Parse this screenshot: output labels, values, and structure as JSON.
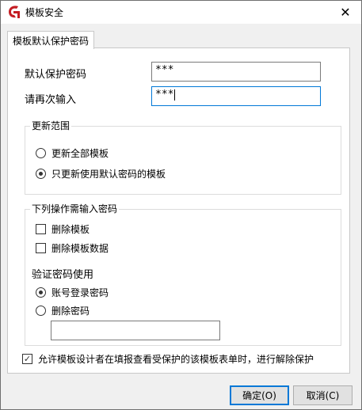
{
  "window": {
    "title": "模板安全",
    "close_glyph": "✕"
  },
  "tabs": [
    {
      "label": "模板默认保护密码"
    }
  ],
  "fields": {
    "default_password": {
      "label": "默认保护密码",
      "value": "***"
    },
    "reenter_password": {
      "label": "请再次输入",
      "value": "***"
    }
  },
  "update_scope": {
    "title": "更新范围",
    "options": [
      {
        "label": "更新全部模板",
        "selected": false
      },
      {
        "label": "只更新使用默认密码的模板",
        "selected": true
      }
    ]
  },
  "ops_require_password": {
    "title": "下列操作需输入密码",
    "items": [
      {
        "label": "删除模板",
        "checked": false
      },
      {
        "label": "删除模板数据",
        "checked": false
      }
    ],
    "verify_title": "验证密码使用",
    "verify_options": [
      {
        "label": "账号登录密码",
        "selected": true
      },
      {
        "label": "删除密码",
        "selected": false
      }
    ],
    "delete_password_value": ""
  },
  "allow_designer_unprotect": {
    "label": "允许模板设计者在填报查看受保护的该模板表单时，进行解除保护",
    "checked": true
  },
  "buttons": {
    "ok": "确定(O)",
    "cancel": "取消(C)"
  },
  "colors": {
    "accent": "#0078d7",
    "logo": "#c41d23"
  },
  "icons": {
    "app": "app-logo-icon",
    "close": "close-icon",
    "check": "checkmark-icon"
  }
}
